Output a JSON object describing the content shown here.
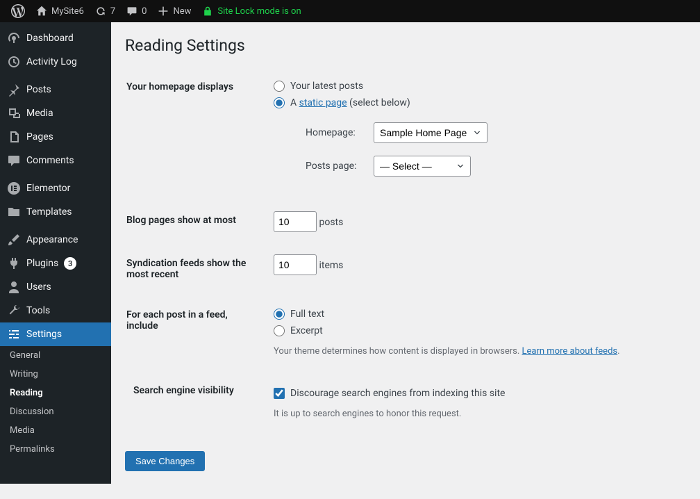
{
  "adminbar": {
    "site_name": "MySite6",
    "updates_count": "7",
    "comments_count": "0",
    "new_label": "New",
    "lock_label": "Site Lock mode is on"
  },
  "sidebar": {
    "dashboard": "Dashboard",
    "activity_log": "Activity Log",
    "posts": "Posts",
    "media": "Media",
    "pages": "Pages",
    "comments": "Comments",
    "elementor": "Elementor",
    "templates": "Templates",
    "appearance": "Appearance",
    "plugins": "Plugins",
    "plugins_count": "3",
    "users": "Users",
    "tools": "Tools",
    "settings": "Settings",
    "sub": {
      "general": "General",
      "writing": "Writing",
      "reading": "Reading",
      "discussion": "Discussion",
      "media": "Media",
      "permalinks": "Permalinks"
    }
  },
  "page": {
    "title": "Reading Settings",
    "homepage_displays": {
      "label": "Your homepage displays",
      "opt_latest": "Your latest posts",
      "opt_static_prefix": "A ",
      "opt_static_link": "static page",
      "opt_static_suffix": " (select below)",
      "homepage_label": "Homepage:",
      "homepage_value": "Sample Home Page",
      "postspage_label": "Posts page:",
      "postspage_value": "— Select —"
    },
    "blog_pages": {
      "label": "Blog pages show at most",
      "value": "10",
      "suffix": "posts"
    },
    "syndication": {
      "label": "Syndication feeds show the most recent",
      "value": "10",
      "suffix": "items"
    },
    "feed_content": {
      "label": "For each post in a feed, include",
      "opt_full": "Full text",
      "opt_excerpt": "Excerpt",
      "desc_prefix": "Your theme determines how content is displayed in browsers. ",
      "desc_link": "Learn more about feeds",
      "desc_suffix": "."
    },
    "search_visibility": {
      "label": "Search engine visibility",
      "checkbox_label": "Discourage search engines from indexing this site",
      "desc": "It is up to search engines to honor this request."
    },
    "save_button": "Save Changes"
  }
}
